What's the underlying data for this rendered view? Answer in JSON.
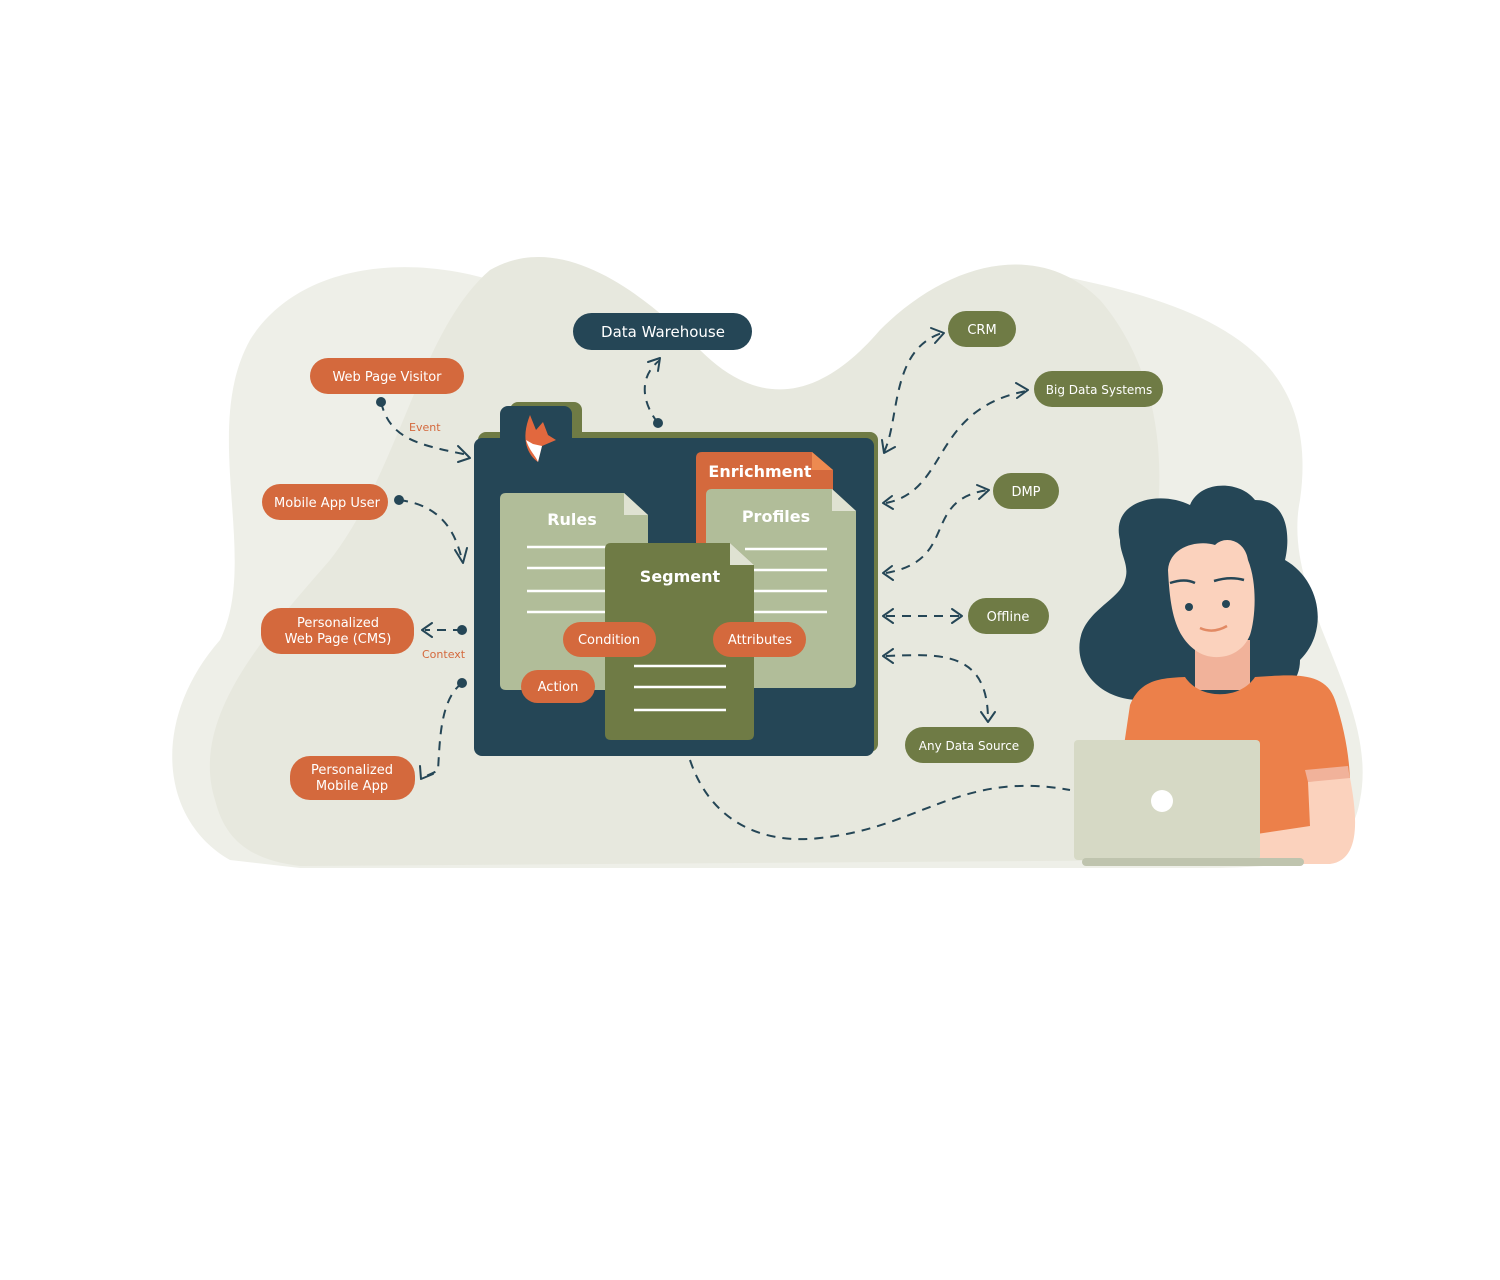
{
  "colors": {
    "navy": "#254656",
    "olive": "#6f7b45",
    "orange": "#d4693d",
    "sage": "#b1bd99",
    "background": "#e9eae1"
  },
  "center": {
    "documents": {
      "rules": "Rules",
      "enrichment": "Enrichment",
      "profiles": "Profiles",
      "segment": "Segment"
    },
    "tags": {
      "condition": "Condition",
      "attributes": "Attributes",
      "action": "Action"
    },
    "logo": "fox-logo"
  },
  "top": {
    "data_warehouse": "Data Warehouse"
  },
  "left": {
    "web_page_visitor": "Web Page Visitor",
    "event_label": "Event",
    "mobile_app_user": "Mobile App User",
    "personalized_web_page": [
      "Personalized",
      "Web Page (CMS)"
    ],
    "context_label": "Context",
    "personalized_mobile_app": [
      "Personalized",
      "Mobile App"
    ]
  },
  "right": {
    "crm": "CRM",
    "big_data": "Big Data Systems",
    "dmp": "DMP",
    "offline": "Offline",
    "any_data_source": "Any Data Source"
  }
}
